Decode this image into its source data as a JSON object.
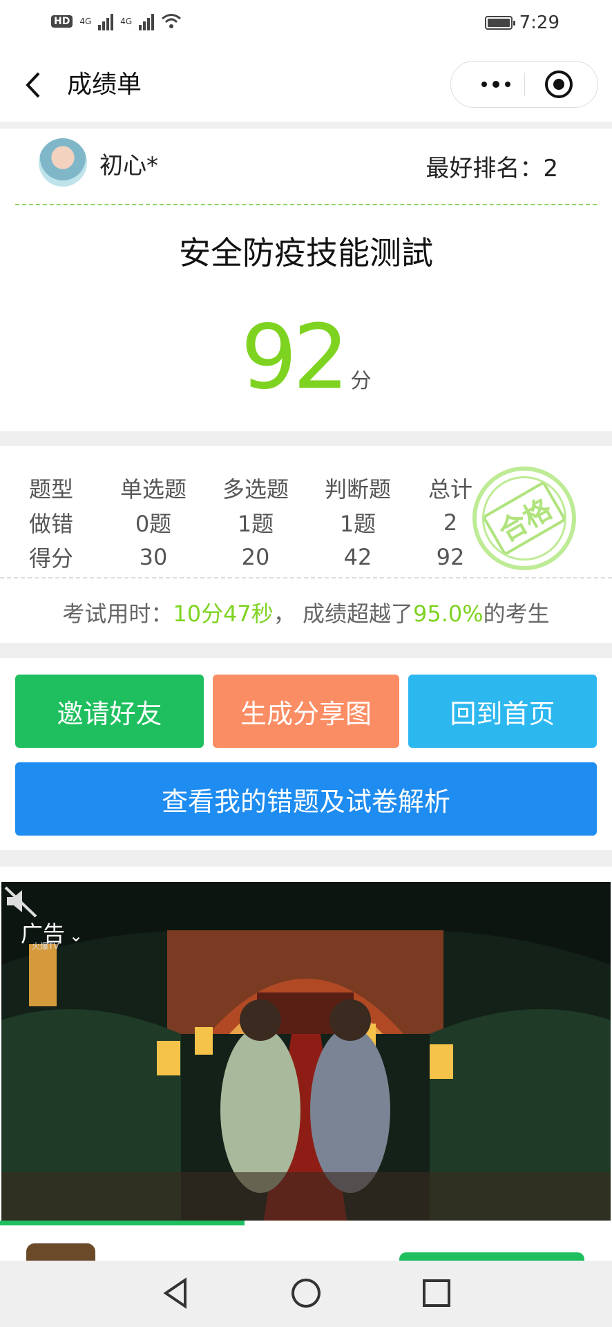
{
  "status_bar": {
    "network_hd": "HD",
    "network_4g_1": "4G",
    "network_4g_2": "4G",
    "time": "7:29"
  },
  "header": {
    "title": "成绩单"
  },
  "profile": {
    "username": "初心*",
    "best_rank_label": "最好排名：",
    "best_rank_value": "2"
  },
  "exam": {
    "title": "安全防疫技能测試",
    "score": "92",
    "score_unit": "分"
  },
  "stats": {
    "headers": [
      "题型",
      "单选题",
      "多选题",
      "判断题",
      "总计"
    ],
    "wrong_row": [
      "做错",
      "0题",
      "1题",
      "1题",
      "2"
    ],
    "score_row": [
      "得分",
      "30",
      "20",
      "42",
      "92"
    ],
    "stamp_text": "合格",
    "summary_prefix": "考试用时：",
    "duration": "10分47秒",
    "summary_mid": "， 成绩超越了",
    "percent": "95.0%",
    "summary_suffix": "的考生"
  },
  "buttons": {
    "invite": "邀请好友",
    "share": "生成分享图",
    "home": "回到首页",
    "review": "查看我的错题及试卷解析"
  },
  "ad": {
    "label": "广告",
    "source": "火爆TV",
    "progress": 0.4
  },
  "colors": {
    "green": "#7ed321",
    "invite": "#1fbf5f",
    "share": "#fb8d64",
    "home": "#2db7ef",
    "review": "#1e8cf0"
  }
}
